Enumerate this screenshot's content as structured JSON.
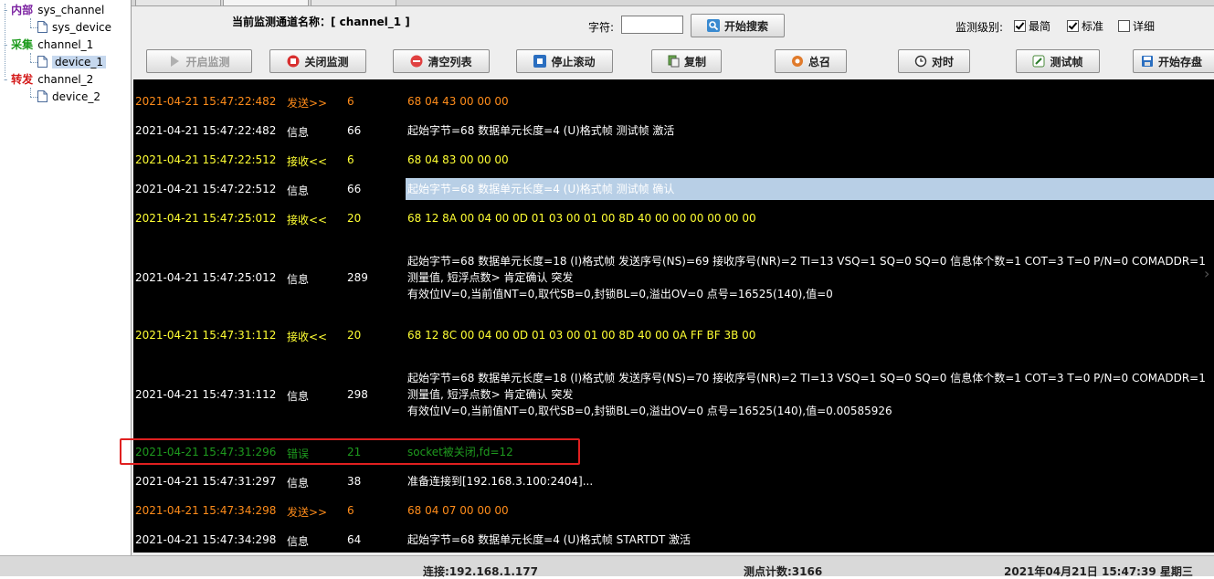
{
  "tree": {
    "groups": [
      {
        "category": "内部",
        "category_color": "#7a1fa0",
        "channel": "sys_channel",
        "devices": [
          "sys_device"
        ]
      },
      {
        "category": "采集",
        "category_color": "#1a9a1a",
        "channel": "channel_1",
        "devices": [
          "device_1"
        ]
      },
      {
        "category": "转发",
        "category_color": "#d41a1a",
        "channel": "channel_2",
        "devices": [
          "device_2"
        ]
      }
    ],
    "selected_device": "device_1"
  },
  "header": {
    "title": "当前监测通道名称：[ channel_1 ]",
    "char_label": "字符:",
    "char_value": "",
    "search_button": "开始搜索",
    "level_label": "监测级别:",
    "levels": [
      {
        "label": "最简",
        "checked": true
      },
      {
        "label": "标准",
        "checked": true
      },
      {
        "label": "详细",
        "checked": false
      }
    ]
  },
  "toolbar": {
    "start_monitor": "开启监测",
    "stop_monitor": "关闭监测",
    "clear_list": "清空列表",
    "stop_scroll": "停止滚动",
    "copy": "复制",
    "general_call": "总召",
    "time_sync": "对时",
    "test_frame": "测试帧",
    "start_save": "开始存盘"
  },
  "colors": {
    "send": "#ff8c1a",
    "info": "#ffffff",
    "recv": "#ffff33",
    "error": "#1e9a1e",
    "selection": "#b8cfe6",
    "highlight_box": "#e02020"
  },
  "log": {
    "rows": [
      {
        "time": "2021-04-21 15:47:22:482",
        "type": "发送>>",
        "len": "6",
        "kind": "send",
        "lines": [
          "68 04 43 00 00 00"
        ]
      },
      {
        "time": "2021-04-21 15:47:22:482",
        "type": "信息",
        "len": "66",
        "kind": "info",
        "lines": [
          "起始字节=68 数据单元长度=4 (U)格式帧 测试帧 激活"
        ]
      },
      {
        "time": "2021-04-21 15:47:22:512",
        "type": "接收<<",
        "len": "6",
        "kind": "recv",
        "lines": [
          "68 04 83 00 00 00"
        ]
      },
      {
        "time": "2021-04-21 15:47:22:512",
        "type": "信息",
        "len": "66",
        "kind": "info",
        "selected": true,
        "lines": [
          "起始字节=68 数据单元长度=4 (U)格式帧 测试帧 确认"
        ]
      },
      {
        "time": "2021-04-21 15:47:25:012",
        "type": "接收<<",
        "len": "20",
        "kind": "recv",
        "lines": [
          "68 12 8A 00 04 00 0D 01 03 00 01 00 8D 40 00 00 00 00 00 00"
        ]
      },
      {
        "time": "2021-04-21 15:47:25:012",
        "type": "信息",
        "len": "289",
        "kind": "info",
        "lines": [
          "起始字节=68 数据单元长度=18 (I)格式帧 发送序号(NS)=69 接收序号(NR)=2 TI=13 VSQ=1 SQ=0 SQ=0 信息体个数=1 COT=3 T=0 P/N=0 COMADDR=1",
          "测量值, 短浮点数> 肯定确认 突发",
          "有效位IV=0,当前值NT=0,取代SB=0,封锁BL=0,溢出OV=0 点号=16525(140),值=0"
        ]
      },
      {
        "time": "2021-04-21 15:47:31:112",
        "type": "接收<<",
        "len": "20",
        "kind": "recv",
        "lines": [
          "68 12 8C 00 04 00 0D 01 03 00 01 00 8D 40 00 0A FF BF 3B 00"
        ]
      },
      {
        "time": "2021-04-21 15:47:31:112",
        "type": "信息",
        "len": "298",
        "kind": "info",
        "lines": [
          "起始字节=68 数据单元长度=18 (I)格式帧 发送序号(NS)=70 接收序号(NR)=2 TI=13 VSQ=1 SQ=0 SQ=0 信息体个数=1 COT=3 T=0 P/N=0 COMADDR=1",
          "测量值, 短浮点数> 肯定确认 突发",
          "有效位IV=0,当前值NT=0,取代SB=0,封锁BL=0,溢出OV=0 点号=16525(140),值=0.00585926"
        ]
      },
      {
        "time": "2021-04-21 15:47:31:296",
        "type": "错误",
        "len": "21",
        "kind": "error",
        "lines": [
          "socket被关闭,fd=12"
        ]
      },
      {
        "time": "2021-04-21 15:47:31:297",
        "type": "信息",
        "len": "38",
        "kind": "info",
        "lines": [
          "准备连接到[192.168.3.100:2404]..."
        ]
      },
      {
        "time": "2021-04-21 15:47:34:298",
        "type": "发送>>",
        "len": "6",
        "kind": "send",
        "lines": [
          "68 04 07 00 00 00"
        ]
      },
      {
        "time": "2021-04-21 15:47:34:298",
        "type": "信息",
        "len": "64",
        "kind": "info",
        "lines": [
          "起始字节=68 数据单元长度=4 (U)格式帧 STARTDT 激活"
        ]
      }
    ]
  },
  "status": {
    "connection": "连接:192.168.1.177",
    "point_count": "测点计数:3166",
    "datetime": "2021年04月21日 15:47:39 星期三"
  }
}
